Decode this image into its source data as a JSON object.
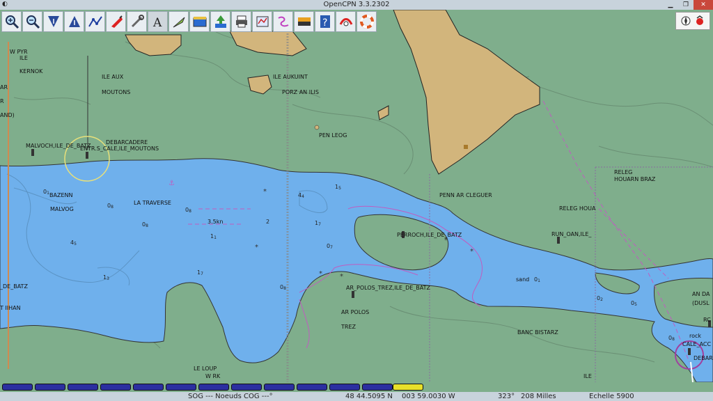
{
  "window": {
    "title": "OpenCPN 3.3.2302"
  },
  "toolbar": {
    "buttons": [
      {
        "name": "zoom-in-button",
        "icon": "zoom-in-icon"
      },
      {
        "name": "zoom-out-button",
        "icon": "zoom-out-icon"
      },
      {
        "name": "scale-in-button",
        "icon": "scale-in-icon"
      },
      {
        "name": "scale-out-button",
        "icon": "scale-out-icon"
      },
      {
        "name": "create-route-button",
        "icon": "route-icon"
      },
      {
        "name": "auto-follow-button",
        "icon": "ship-icon"
      },
      {
        "name": "settings-button",
        "icon": "tools-icon"
      },
      {
        "name": "text-button",
        "icon": "text-icon"
      },
      {
        "name": "current-button",
        "icon": "current-icon"
      },
      {
        "name": "tide-button",
        "icon": "tide-icon"
      },
      {
        "name": "tide-up-button",
        "icon": "tide-up-icon"
      },
      {
        "name": "print-button",
        "icon": "print-icon"
      },
      {
        "name": "route-manager-button",
        "icon": "route-manager-icon"
      },
      {
        "name": "track-button",
        "icon": "track-icon"
      },
      {
        "name": "color-scheme-button",
        "icon": "color-scheme-icon"
      },
      {
        "name": "help-button",
        "icon": "help-icon"
      },
      {
        "name": "mob-button",
        "icon": "mob-icon"
      },
      {
        "name": "lifebuoy-button",
        "icon": "lifebuoy-icon"
      }
    ]
  },
  "chart": {
    "labels": {
      "w_pyr": "W PYR",
      "ile1": "ILE",
      "kernok": "KERNOK",
      "ar_left": "AR",
      "r_left": "R",
      "and_left": "AND)",
      "ile_aux": "ILE AUX",
      "moutons": "MOUTONS",
      "ile_aukuint": "ILE AUKUINT",
      "porz_an_ilis": "PORZ AN ILIS",
      "pen_leog": "PEN LEOG",
      "malvoch": "MALVOCH,ILE_DE_BATZ",
      "entr_cale": "ENTR.S_CALE,ILE_MOUTONS",
      "debarcadere": "DEBARCADERE",
      "bazenn": "BAZENN",
      "malvog": "MALVOG",
      "la_traverse": "LA TRAVERSE",
      "penn_ar_cleguer": "PENN AR CLEGUER",
      "releg_houarn": "RELEG",
      "houarn_braz": "HOUARN BRAZ",
      "releg_houa": "RELEG HOUA",
      "perroch": "PERROCH,ILE_DE_BATZ",
      "run_oan": "RUN_OAN,ILE_",
      "de_batz_left": "_DE_BATZ",
      "t_iihan": "T IIHAN",
      "ar_polos_trez": "AR_POLOS_TREZ,ILE_DE_BATZ",
      "ar_polos": "AR POLOS",
      "trez": "TREZ",
      "sand": "sand",
      "banc_bistarz": "BANC BISTARZ",
      "an_da": "AN DA",
      "dusl": "(DUSL",
      "rc": "RC",
      "rock": "rock",
      "cale_acc": "CALE_ACC",
      "debar": "DEBAR",
      "le_loup": "LE LOUP",
      "w_rk": "W RK",
      "ile_bottom": "ILE",
      "current_speed": "3.5kn"
    },
    "soundings": [
      {
        "m": "0",
        "d": "1"
      },
      {
        "m": "0",
        "d": "8"
      },
      {
        "m": "0",
        "d": "8"
      },
      {
        "m": "0",
        "d": "8"
      },
      {
        "m": "4",
        "d": "5"
      },
      {
        "m": "1",
        "d": "1"
      },
      {
        "m": "1",
        "d": "3"
      },
      {
        "m": "1",
        "d": "7"
      },
      {
        "m": "2",
        "d": ""
      },
      {
        "m": "4",
        "d": "4"
      },
      {
        "m": "1",
        "d": "5"
      },
      {
        "m": "1",
        "d": "7"
      },
      {
        "m": "0",
        "d": "7"
      },
      {
        "m": "0",
        "d": "8"
      },
      {
        "m": "0",
        "d": "1"
      },
      {
        "m": "0",
        "d": "2"
      },
      {
        "m": "0",
        "d": "5"
      },
      {
        "m": "0",
        "d": "8"
      }
    ]
  },
  "status": {
    "sog": "SOG --- Noeuds COG ---°",
    "lat": "48 44.5095 N",
    "lon": "003 59.0030 W",
    "bearing": "323°",
    "distance": "208 Milles",
    "scale": "Echelle 5900"
  },
  "colors": {
    "land": "#7fae8c",
    "water": "#6fb0ec",
    "dry_land": "#d2b57c",
    "boundary": "#c05cc0"
  }
}
